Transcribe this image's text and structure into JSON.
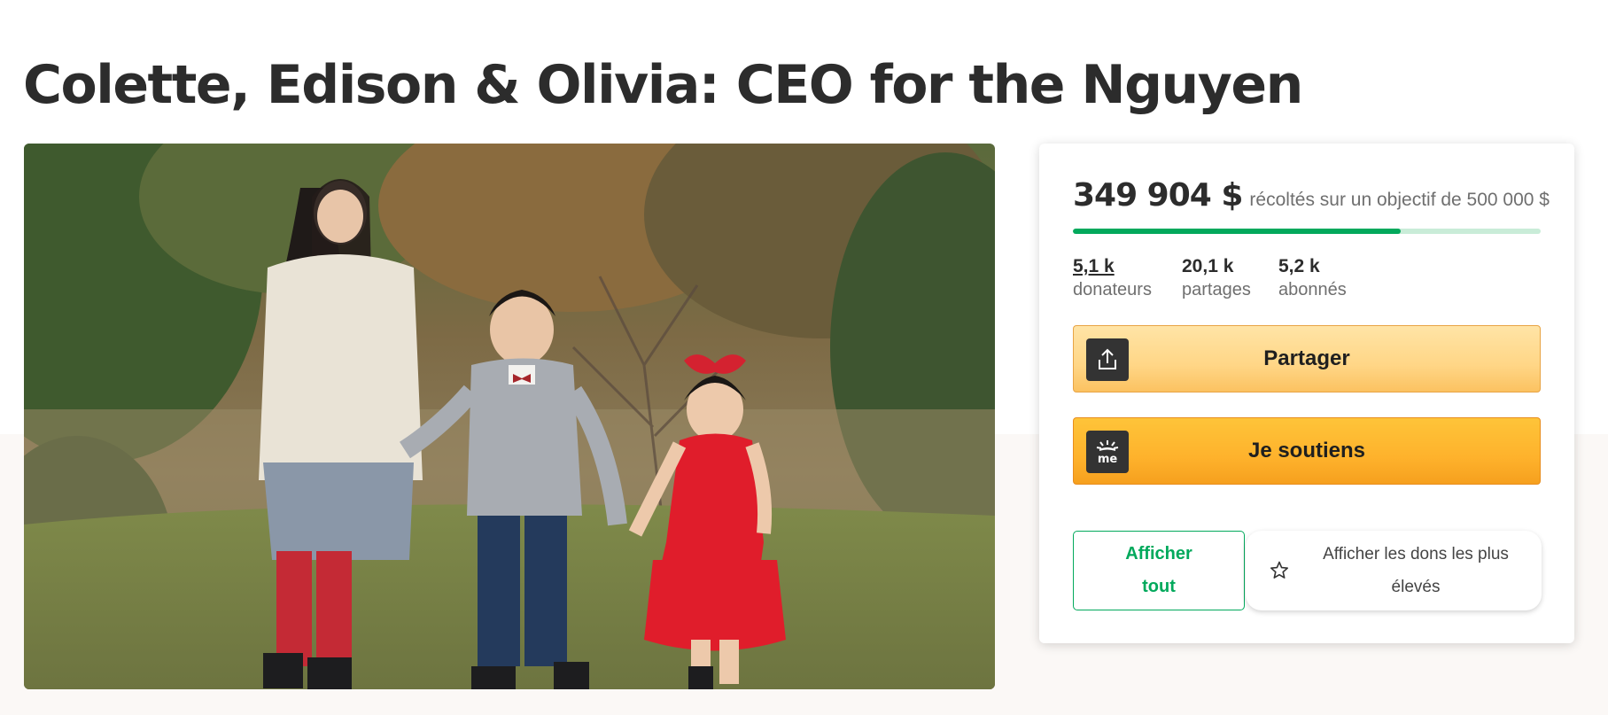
{
  "campaign": {
    "title": "Colette, Edison & Olivia: CEO for the Nguyen"
  },
  "hero": {
    "image_description": "photo-of-three-children-holding-hands-in-a-field"
  },
  "donation": {
    "raised_amount": "349 904 $",
    "raised_text": "récoltés sur un objectif de 500 000 $",
    "progress_fraction": 0.7,
    "stats": [
      {
        "value": "5,1 k",
        "label": "donateurs"
      },
      {
        "value": "20,1 k",
        "label": "partages"
      },
      {
        "value": "5,2 k",
        "label": "abonnés"
      }
    ],
    "share_button": {
      "label": "Partager",
      "icon": "share-upload-icon"
    },
    "donate_button": {
      "label": "Je soutiens",
      "icon": "gofundme-logo-icon"
    },
    "see_all_button": {
      "label": "Afficher tout"
    },
    "top_donations_button": {
      "label": "Afficher les dons les plus élevés",
      "icon": "star-outline-icon"
    }
  },
  "colors": {
    "accent_green": "#02a95c",
    "progress_track": "#c9ecd8",
    "share_yellow": "#ffd686",
    "donate_orange": "#feb22c",
    "text_dark": "#2c2c2c"
  }
}
